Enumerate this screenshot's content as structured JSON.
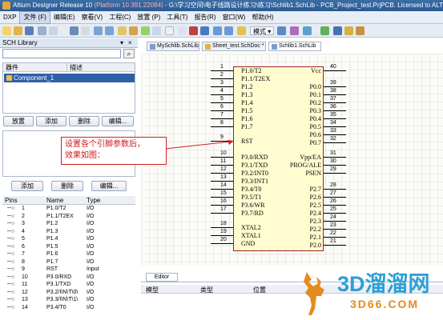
{
  "window": {
    "title": "Altium Designer Release 10",
    "platform": "(Platform 10.391.22084)",
    "path": " - G:\\学习空间\\电子线路设计练习\\练习\\Schlib1.SchLib - PCB_Project_test.PrjPCB. Licensed to ALTIUM"
  },
  "menu": [
    "DXP",
    "文件 (F)",
    "编辑(E)",
    "察看(V)",
    "工程(C)",
    "放置 (P)",
    "工具(T)",
    "报告(R)",
    "窗口(W)",
    "帮助(H)"
  ],
  "toolbar": {
    "mode_label": "模式"
  },
  "library_panel": {
    "title": "SCH Library",
    "col_component": "器件",
    "col_desc": "描述",
    "selected_component": "Component_1",
    "buttons": [
      "放置",
      "添加",
      "删除",
      "编辑..."
    ],
    "alias_label": "别名",
    "alias_buttons": [
      "添加",
      "删除",
      "编辑..."
    ],
    "pins_cols": [
      "Pins",
      "Name",
      "Type"
    ],
    "pins": [
      {
        "n": "1",
        "name": "P1.0/T2",
        "type": "I/O"
      },
      {
        "n": "2",
        "name": "P1.1/T2EX",
        "type": "I/O"
      },
      {
        "n": "3",
        "name": "P1.2",
        "type": "I/O"
      },
      {
        "n": "4",
        "name": "P1.3",
        "type": "I/O"
      },
      {
        "n": "5",
        "name": "P1.4",
        "type": "I/O"
      },
      {
        "n": "6",
        "name": "P1.5",
        "type": "I/O"
      },
      {
        "n": "7",
        "name": "P1.6",
        "type": "I/O"
      },
      {
        "n": "8",
        "name": "P1.7",
        "type": "I/O"
      },
      {
        "n": "9",
        "name": "RST",
        "type": "Input"
      },
      {
        "n": "10",
        "name": "P3.0/RXD",
        "type": "I/O"
      },
      {
        "n": "11",
        "name": "P3.1/TXD",
        "type": "I/O"
      },
      {
        "n": "12",
        "name": "P3.2/I\\N\\T\\0\\",
        "type": "I/O"
      },
      {
        "n": "13",
        "name": "P3.3/I\\N\\T\\1\\",
        "type": "I/O"
      },
      {
        "n": "14",
        "name": "P3.4/T0",
        "type": "I/O"
      }
    ]
  },
  "tabs": [
    "MySchlib.SchLib",
    "Sheet_test.SchDoc *",
    "Schlib1.SchLib"
  ],
  "schematic": {
    "left_pins": [
      {
        "n": "1",
        "label": "P1.0/T2"
      },
      {
        "n": "2",
        "label": "P1.1/T2EX"
      },
      {
        "n": "3",
        "label": "P1.2"
      },
      {
        "n": "4",
        "label": "P1.3"
      },
      {
        "n": "5",
        "label": "P1.4"
      },
      {
        "n": "6",
        "label": "P1.5"
      },
      {
        "n": "7",
        "label": "P1.6"
      },
      {
        "n": "8",
        "label": "P1.7"
      },
      {
        "n": "9",
        "label": "RST"
      },
      {
        "n": "10",
        "label": "P3.0/RXD"
      },
      {
        "n": "11",
        "label": "P3.1/TXD"
      },
      {
        "n": "12",
        "label": "P3.2/INT0"
      },
      {
        "n": "13",
        "label": "P3.3/INT1"
      },
      {
        "n": "14",
        "label": "P3.4/T0"
      },
      {
        "n": "15",
        "label": "P3.5/T1"
      },
      {
        "n": "16",
        "label": "P3.6/WR"
      },
      {
        "n": "17",
        "label": "P3.7/RD"
      },
      {
        "n": "18",
        "label": "XTAL2"
      },
      {
        "n": "19",
        "label": "XTAL1"
      },
      {
        "n": "20",
        "label": "GND"
      }
    ],
    "right_pins": [
      {
        "n": "40",
        "label": "Vcc"
      },
      {
        "n": "39",
        "label": "P0.0"
      },
      {
        "n": "38",
        "label": "P0.1"
      },
      {
        "n": "37",
        "label": "P0.2"
      },
      {
        "n": "36",
        "label": "P0.3"
      },
      {
        "n": "35",
        "label": "P0.4"
      },
      {
        "n": "34",
        "label": "P0.5"
      },
      {
        "n": "33",
        "label": "P0.6"
      },
      {
        "n": "32",
        "label": "P0.7"
      },
      {
        "n": "31",
        "label": "Vpp/EA"
      },
      {
        "n": "30",
        "label": "PROG/ALE"
      },
      {
        "n": "29",
        "label": "PSEN"
      },
      {
        "n": "28",
        "label": "P2.7"
      },
      {
        "n": "27",
        "label": "P2.6"
      },
      {
        "n": "26",
        "label": "P2.5"
      },
      {
        "n": "25",
        "label": "P2.4"
      },
      {
        "n": "24",
        "label": "P2.3"
      },
      {
        "n": "23",
        "label": "P2.2"
      },
      {
        "n": "22",
        "label": "P2.1"
      },
      {
        "n": "21",
        "label": "P2.0"
      }
    ]
  },
  "note_text": "设置各个引脚参数后，\n效果如图：",
  "editor": {
    "tab": "Editor",
    "cols": [
      "模型",
      "类型",
      "位置"
    ]
  },
  "watermark": {
    "big": "3D溜溜网",
    "small": "3D66.COM"
  }
}
